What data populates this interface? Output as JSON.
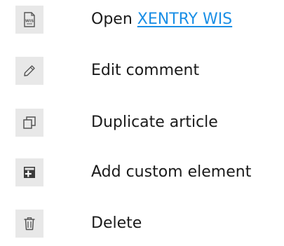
{
  "actions": [
    {
      "icon": "wis-document-icon",
      "prefix": "Open ",
      "link": "XENTRY WIS",
      "label": ""
    },
    {
      "icon": "pencil-icon",
      "label": "Edit comment"
    },
    {
      "icon": "duplicate-icon",
      "label": "Duplicate article"
    },
    {
      "icon": "add-custom-element-icon",
      "label": "Add custom element"
    },
    {
      "icon": "trash-icon",
      "label": "Delete"
    }
  ],
  "colors": {
    "icon_background": "#e8e8e8",
    "link": "#1a8fe6",
    "text": "#1a1a1a",
    "icon": "#555555"
  }
}
